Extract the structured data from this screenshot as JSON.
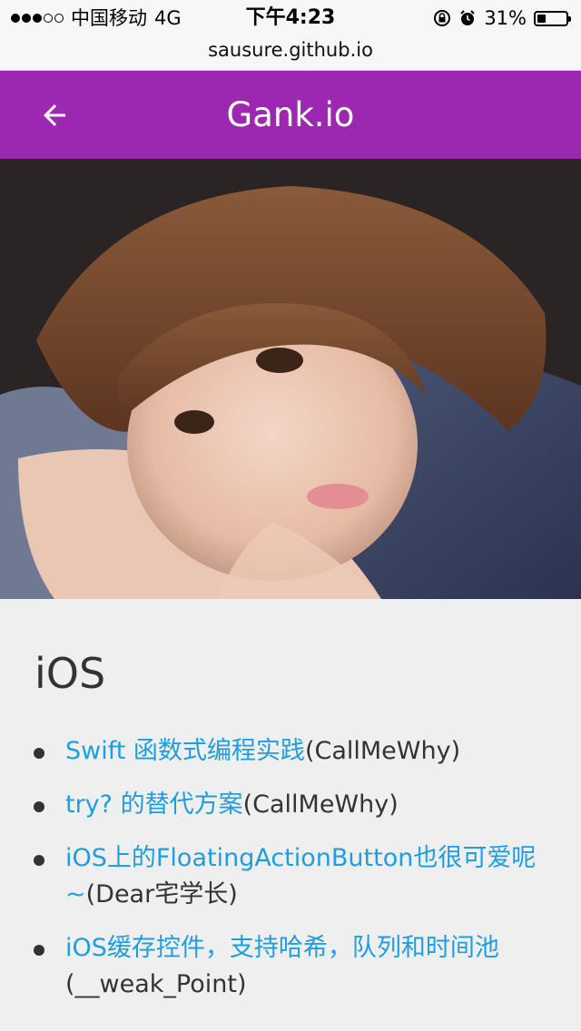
{
  "status_bar": {
    "carrier": "中国移动",
    "network": "4G",
    "time": "下午4:23",
    "battery_percent": "31%",
    "battery_level": 0.31,
    "signal_bars_filled": 3,
    "signal_bars_total": 5
  },
  "url_bar": {
    "url": "sausure.github.io"
  },
  "app_bar": {
    "title": "Gank.io",
    "back_icon": "arrow-left-icon",
    "background_color": "#9c27b0"
  },
  "content": {
    "section_title": "iOS",
    "items": [
      {
        "title": "Swift 函数式编程实践",
        "author": "(CallMeWhy)"
      },
      {
        "title": "try? 的替代方案",
        "author": "(CallMeWhy)"
      },
      {
        "title": "iOS上的FloatingActionButton也很可爱呢~",
        "author": "(Dear宅学长)"
      },
      {
        "title": "iOS缓存控件，支持哈希，队列和时间池",
        "author": "(__weak_Point)"
      }
    ],
    "link_color": "#1e9ee0"
  }
}
